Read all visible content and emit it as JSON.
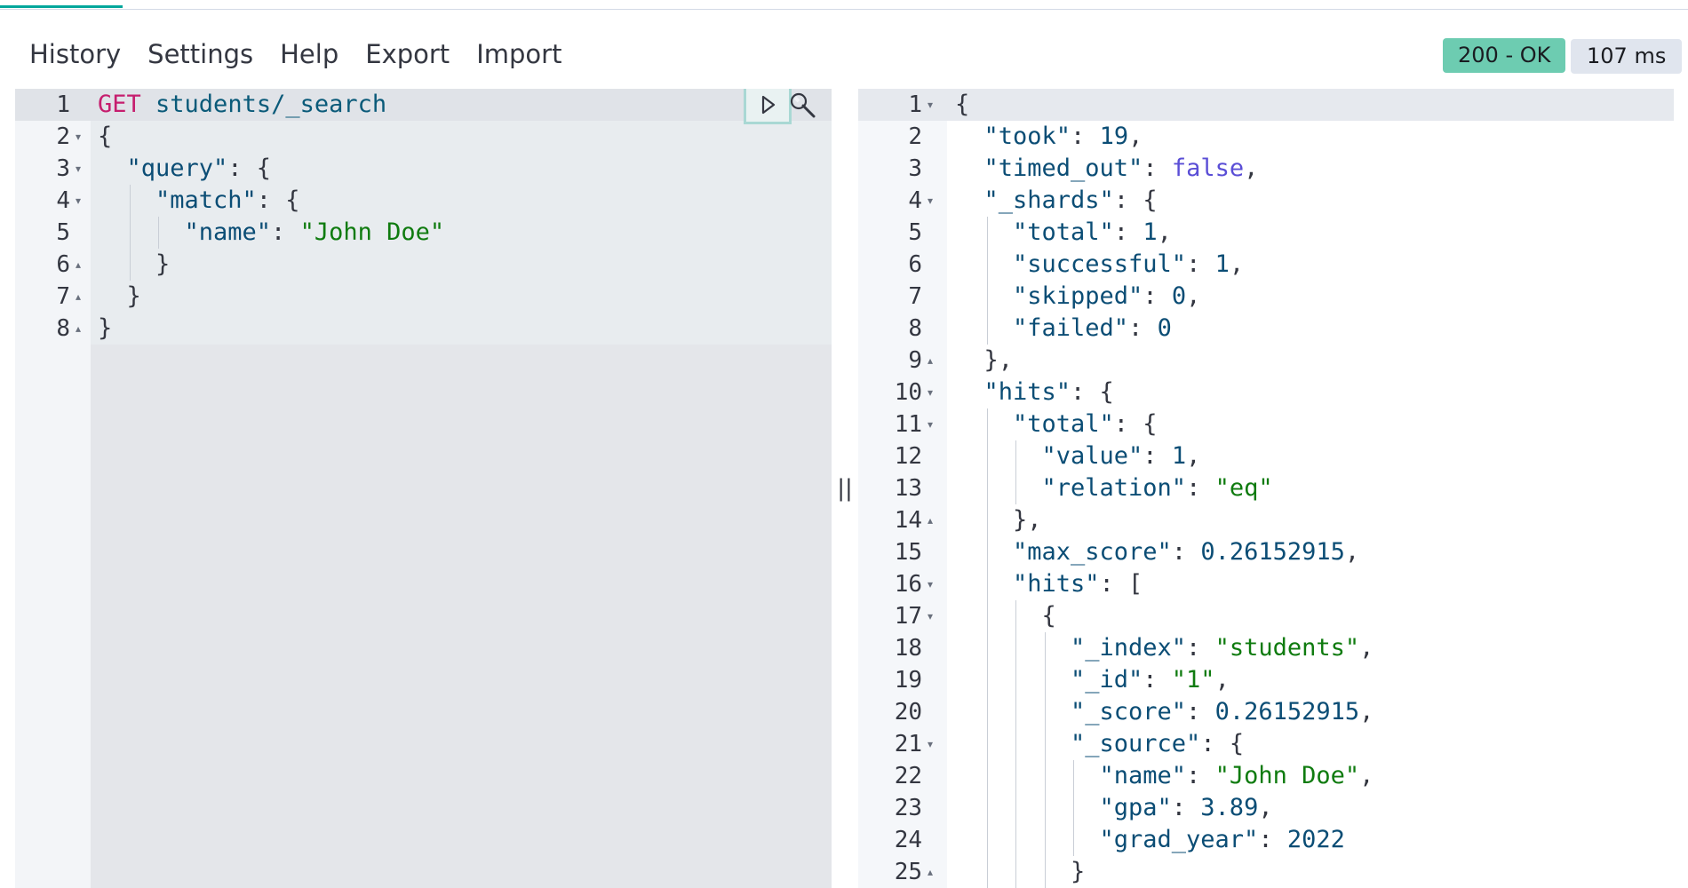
{
  "menu": {
    "items": [
      "History",
      "Settings",
      "Help",
      "Export",
      "Import"
    ]
  },
  "response_status": {
    "status_text": "200 - OK",
    "time_text": "107 ms",
    "status_color": "#6dccb1"
  },
  "icons": {
    "run": "play-icon",
    "tools": "wrench-icon",
    "resizer": "double-bar-resizer-icon"
  },
  "resizer_glyph": "||",
  "request_editor": {
    "lines": [
      {
        "n": "1",
        "fold": "",
        "indent": 0,
        "tokens": [
          {
            "t": "GET",
            "c": "method"
          },
          {
            "t": " students/_search",
            "c": "url"
          }
        ]
      },
      {
        "n": "2",
        "fold": "down",
        "indent": 0,
        "tokens": [
          {
            "t": "{",
            "c": "punc"
          }
        ]
      },
      {
        "n": "3",
        "fold": "down",
        "indent": 1,
        "tokens": [
          {
            "t": "\"query\"",
            "c": "key"
          },
          {
            "t": ": {",
            "c": "punc"
          }
        ]
      },
      {
        "n": "4",
        "fold": "down",
        "indent": 2,
        "tokens": [
          {
            "t": "\"match\"",
            "c": "key"
          },
          {
            "t": ": {",
            "c": "punc"
          }
        ]
      },
      {
        "n": "5",
        "fold": "",
        "indent": 3,
        "tokens": [
          {
            "t": "\"name\"",
            "c": "key"
          },
          {
            "t": ": ",
            "c": "punc"
          },
          {
            "t": "\"John Doe\"",
            "c": "str"
          }
        ]
      },
      {
        "n": "6",
        "fold": "up",
        "indent": 2,
        "tokens": [
          {
            "t": "}",
            "c": "punc"
          }
        ]
      },
      {
        "n": "7",
        "fold": "up",
        "indent": 1,
        "tokens": [
          {
            "t": "}",
            "c": "punc"
          }
        ]
      },
      {
        "n": "8",
        "fold": "up",
        "indent": 0,
        "tokens": [
          {
            "t": "}",
            "c": "punc"
          }
        ]
      }
    ]
  },
  "response_viewer": {
    "lines": [
      {
        "n": "1",
        "fold": "down",
        "indent": 0,
        "tokens": [
          {
            "t": "{",
            "c": "punc"
          }
        ]
      },
      {
        "n": "2",
        "fold": "",
        "indent": 1,
        "tokens": [
          {
            "t": "\"took\"",
            "c": "key"
          },
          {
            "t": ": ",
            "c": "punc"
          },
          {
            "t": "19",
            "c": "num"
          },
          {
            "t": ",",
            "c": "punc"
          }
        ]
      },
      {
        "n": "3",
        "fold": "",
        "indent": 1,
        "tokens": [
          {
            "t": "\"timed_out\"",
            "c": "key"
          },
          {
            "t": ": ",
            "c": "punc"
          },
          {
            "t": "false",
            "c": "bool"
          },
          {
            "t": ",",
            "c": "punc"
          }
        ]
      },
      {
        "n": "4",
        "fold": "down",
        "indent": 1,
        "tokens": [
          {
            "t": "\"_shards\"",
            "c": "key"
          },
          {
            "t": ": {",
            "c": "punc"
          }
        ]
      },
      {
        "n": "5",
        "fold": "",
        "indent": 2,
        "tokens": [
          {
            "t": "\"total\"",
            "c": "key"
          },
          {
            "t": ": ",
            "c": "punc"
          },
          {
            "t": "1",
            "c": "num"
          },
          {
            "t": ",",
            "c": "punc"
          }
        ]
      },
      {
        "n": "6",
        "fold": "",
        "indent": 2,
        "tokens": [
          {
            "t": "\"successful\"",
            "c": "key"
          },
          {
            "t": ": ",
            "c": "punc"
          },
          {
            "t": "1",
            "c": "num"
          },
          {
            "t": ",",
            "c": "punc"
          }
        ]
      },
      {
        "n": "7",
        "fold": "",
        "indent": 2,
        "tokens": [
          {
            "t": "\"skipped\"",
            "c": "key"
          },
          {
            "t": ": ",
            "c": "punc"
          },
          {
            "t": "0",
            "c": "num"
          },
          {
            "t": ",",
            "c": "punc"
          }
        ]
      },
      {
        "n": "8",
        "fold": "",
        "indent": 2,
        "tokens": [
          {
            "t": "\"failed\"",
            "c": "key"
          },
          {
            "t": ": ",
            "c": "punc"
          },
          {
            "t": "0",
            "c": "num"
          }
        ]
      },
      {
        "n": "9",
        "fold": "up",
        "indent": 1,
        "tokens": [
          {
            "t": "},",
            "c": "punc"
          }
        ]
      },
      {
        "n": "10",
        "fold": "down",
        "indent": 1,
        "tokens": [
          {
            "t": "\"hits\"",
            "c": "key"
          },
          {
            "t": ": {",
            "c": "punc"
          }
        ]
      },
      {
        "n": "11",
        "fold": "down",
        "indent": 2,
        "tokens": [
          {
            "t": "\"total\"",
            "c": "key"
          },
          {
            "t": ": {",
            "c": "punc"
          }
        ]
      },
      {
        "n": "12",
        "fold": "",
        "indent": 3,
        "tokens": [
          {
            "t": "\"value\"",
            "c": "key"
          },
          {
            "t": ": ",
            "c": "punc"
          },
          {
            "t": "1",
            "c": "num"
          },
          {
            "t": ",",
            "c": "punc"
          }
        ]
      },
      {
        "n": "13",
        "fold": "",
        "indent": 3,
        "tokens": [
          {
            "t": "\"relation\"",
            "c": "key"
          },
          {
            "t": ": ",
            "c": "punc"
          },
          {
            "t": "\"eq\"",
            "c": "str"
          }
        ]
      },
      {
        "n": "14",
        "fold": "up",
        "indent": 2,
        "tokens": [
          {
            "t": "},",
            "c": "punc"
          }
        ]
      },
      {
        "n": "15",
        "fold": "",
        "indent": 2,
        "tokens": [
          {
            "t": "\"max_score\"",
            "c": "key"
          },
          {
            "t": ": ",
            "c": "punc"
          },
          {
            "t": "0.26152915",
            "c": "num"
          },
          {
            "t": ",",
            "c": "punc"
          }
        ]
      },
      {
        "n": "16",
        "fold": "down",
        "indent": 2,
        "tokens": [
          {
            "t": "\"hits\"",
            "c": "key"
          },
          {
            "t": ": [",
            "c": "punc"
          }
        ]
      },
      {
        "n": "17",
        "fold": "down",
        "indent": 3,
        "tokens": [
          {
            "t": "{",
            "c": "punc"
          }
        ]
      },
      {
        "n": "18",
        "fold": "",
        "indent": 4,
        "tokens": [
          {
            "t": "\"_index\"",
            "c": "key"
          },
          {
            "t": ": ",
            "c": "punc"
          },
          {
            "t": "\"students\"",
            "c": "str"
          },
          {
            "t": ",",
            "c": "punc"
          }
        ]
      },
      {
        "n": "19",
        "fold": "",
        "indent": 4,
        "tokens": [
          {
            "t": "\"_id\"",
            "c": "key"
          },
          {
            "t": ": ",
            "c": "punc"
          },
          {
            "t": "\"1\"",
            "c": "str"
          },
          {
            "t": ",",
            "c": "punc"
          }
        ]
      },
      {
        "n": "20",
        "fold": "",
        "indent": 4,
        "tokens": [
          {
            "t": "\"_score\"",
            "c": "key"
          },
          {
            "t": ": ",
            "c": "punc"
          },
          {
            "t": "0.26152915",
            "c": "num"
          },
          {
            "t": ",",
            "c": "punc"
          }
        ]
      },
      {
        "n": "21",
        "fold": "down",
        "indent": 4,
        "tokens": [
          {
            "t": "\"_source\"",
            "c": "key"
          },
          {
            "t": ": {",
            "c": "punc"
          }
        ]
      },
      {
        "n": "22",
        "fold": "",
        "indent": 5,
        "tokens": [
          {
            "t": "\"name\"",
            "c": "key"
          },
          {
            "t": ": ",
            "c": "punc"
          },
          {
            "t": "\"John Doe\"",
            "c": "str"
          },
          {
            "t": ",",
            "c": "punc"
          }
        ]
      },
      {
        "n": "23",
        "fold": "",
        "indent": 5,
        "tokens": [
          {
            "t": "\"gpa\"",
            "c": "key"
          },
          {
            "t": ": ",
            "c": "punc"
          },
          {
            "t": "3.89",
            "c": "num"
          },
          {
            "t": ",",
            "c": "punc"
          }
        ]
      },
      {
        "n": "24",
        "fold": "",
        "indent": 5,
        "tokens": [
          {
            "t": "\"grad_year\"",
            "c": "key"
          },
          {
            "t": ": ",
            "c": "punc"
          },
          {
            "t": "2022",
            "c": "num"
          }
        ]
      },
      {
        "n": "25",
        "fold": "up",
        "indent": 4,
        "tokens": [
          {
            "t": "}",
            "c": "punc"
          }
        ]
      }
    ]
  }
}
